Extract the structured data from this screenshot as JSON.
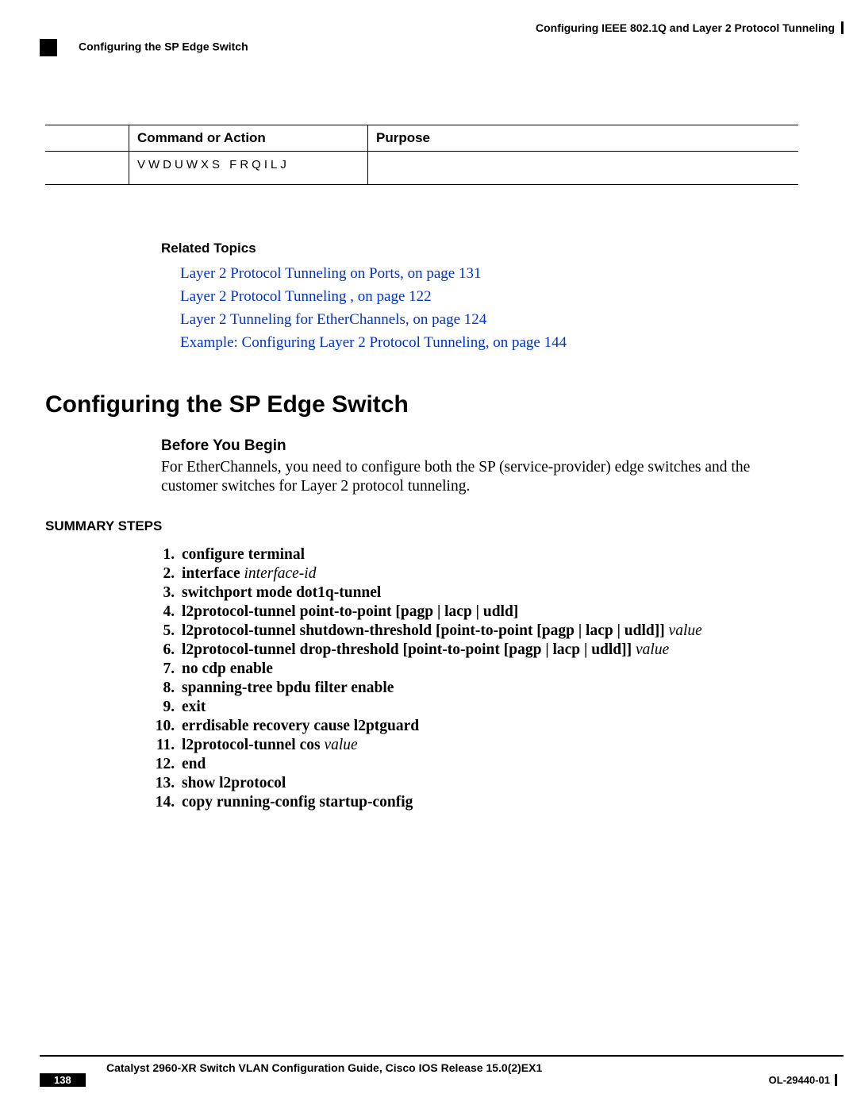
{
  "header": {
    "chapter_title": "Configuring IEEE 802.1Q and Layer 2 Protocol Tunneling",
    "section_title": "Configuring the SP Edge Switch"
  },
  "table": {
    "headers": [
      "",
      "Command or Action",
      "Purpose"
    ],
    "row": {
      "cmd": "VWDUWXS FRQILJ",
      "purpose": ""
    }
  },
  "related": {
    "heading": "Related Topics",
    "links": [
      "Layer 2 Protocol Tunneling on Ports,  on page 131",
      "Layer 2 Protocol Tunneling ,  on page 122",
      "Layer 2 Tunneling for EtherChannels,  on page 124",
      "Example: Configuring Layer 2 Protocol Tunneling,  on page 144"
    ]
  },
  "section": {
    "heading": "Configuring the SP Edge Switch",
    "before_begin_label": "Before You Begin",
    "before_begin_text": "For EtherChannels, you need to configure both the SP (service-provider) edge switches and the customer switches for Layer 2 protocol tunneling."
  },
  "summary": {
    "label": "SUMMARY STEPS",
    "steps": [
      {
        "cmd": "configure terminal"
      },
      {
        "cmd": "interface",
        "arg": "interface-id"
      },
      {
        "cmd": "switchport mode dot1q-tunnel"
      },
      {
        "cmd": "l2protocol-tunnel point-to-point [pagp | lacp | udld]"
      },
      {
        "cmd": "l2protocol-tunnel shutdown-threshold [point-to-point [pagp | lacp | udld]]",
        "arg": "value"
      },
      {
        "cmd": "l2protocol-tunnel drop-threshold [point-to-point [pagp | lacp | udld]]",
        "arg": "value"
      },
      {
        "cmd": "no cdp enable"
      },
      {
        "cmd": "spanning-tree bpdu filter enable"
      },
      {
        "cmd": "exit"
      },
      {
        "cmd": "errdisable recovery cause l2ptguard"
      },
      {
        "cmd": "l2protocol-tunnel cos",
        "arg": "value"
      },
      {
        "cmd": "end"
      },
      {
        "cmd": "show l2protocol"
      },
      {
        "cmd": "copy running-config startup-config"
      }
    ]
  },
  "footer": {
    "guide": "Catalyst 2960-XR Switch VLAN Configuration Guide, Cisco IOS Release 15.0(2)EX1",
    "page": "138",
    "docid": "OL-29440-01"
  }
}
